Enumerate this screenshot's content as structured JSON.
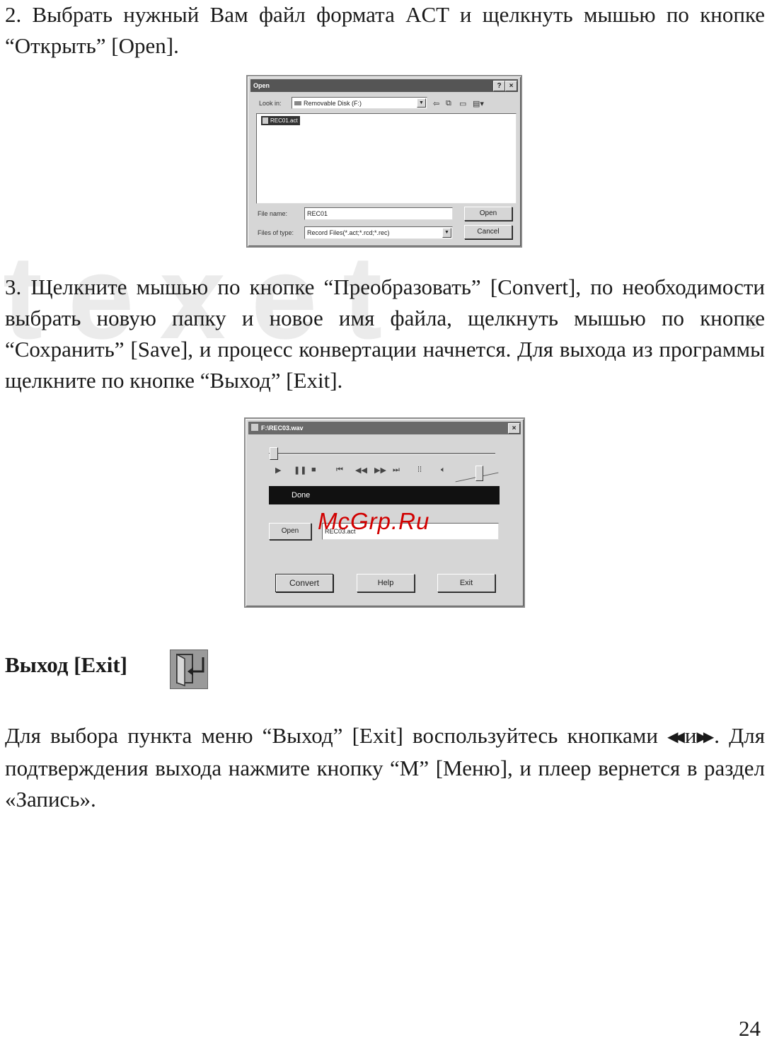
{
  "watermark": {
    "text": "texet",
    "registered": "®"
  },
  "step2": {
    "text": "2. Выбрать нужный Вам файл формата ACT и щелкнуть мышью по кнопке “Открыть” [Open]."
  },
  "open_dialog": {
    "title": "Open",
    "help_btn": "?",
    "close_btn": "×",
    "look_in_label": "Look in:",
    "look_in_value": "Removable Disk (F:)",
    "file_item": "REC01.act",
    "file_name_label": "File name:",
    "file_name_value": "REC01",
    "files_of_type_label": "Files of type:",
    "files_of_type_value": "Record Files(*.act;*.rcd;*.rec)",
    "open_button": "Open",
    "cancel_button": "Cancel"
  },
  "step3": {
    "text": "3.  Щелкните мышью по кнопке “Преобразовать” [Convert], по необходимости выбрать новую папку и новое имя файла, щелкнуть мышью по кнопке “Сохранить” [Save], и процесс конвертации начнется. Для выхода из программы щелкните по кнопке “Выход” [Exit]."
  },
  "converter": {
    "title": "F:\\REC03.wav",
    "close_btn": "×",
    "status": "Done",
    "open_button": "Open",
    "file_value": "REC03.act",
    "convert_button": "Convert",
    "help_button": "Help",
    "exit_button": "Exit"
  },
  "site_mark": "McGrp.Ru",
  "exit_section": {
    "heading": "Выход [Exit]",
    "icon": "exit-door-icon",
    "prev_glyph": "◀◀",
    "next_glyph": "▶▶",
    "text_before": "Для выбора пункта меню “Выход” [Exit] воспользуйтесь кнопками ",
    "text_and": "и",
    "text_after": ". Для подтверждения выхода нажмите кнопку “M” [Меню], и плеер вернется в раздел «Запись»."
  },
  "page_number": "24"
}
